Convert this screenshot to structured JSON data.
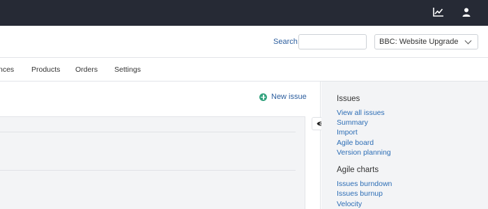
{
  "search": {
    "label": "Search",
    "colon": ":",
    "value": "",
    "placeholder": ""
  },
  "project_select": {
    "selected": "BBC: Website Upgrade"
  },
  "nav": {
    "items": [
      "nces",
      "Products",
      "Orders",
      "Settings"
    ]
  },
  "main": {
    "new_issue_label": "New issue"
  },
  "sidebar": {
    "issues_heading": "Issues",
    "issues_links": [
      "View all issues",
      "Summary",
      "Import",
      "Agile board",
      "Version planning"
    ],
    "agile_heading": "Agile charts",
    "agile_links": [
      "Issues burndown",
      "Issues burnup",
      "Velocity"
    ]
  },
  "icons": {
    "top_chart": "line-chart-icon",
    "top_user": "user-icon",
    "toggle": "eye-icon",
    "new_issue": "plus-circle-icon"
  },
  "colors": {
    "topbar": "#262a35",
    "link": "#2c6db5",
    "accent_green": "#35a37f",
    "sidebar_bg": "#f3f4f6"
  }
}
